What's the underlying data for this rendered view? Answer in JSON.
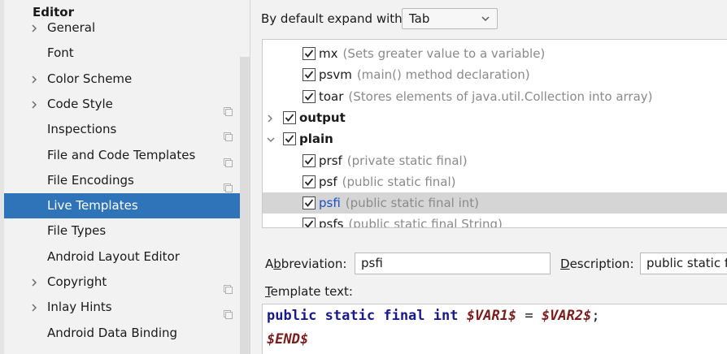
{
  "sidebar": {
    "group_title": "Editor",
    "items": [
      {
        "label": "General",
        "expandable": true,
        "project_icon": false
      },
      {
        "label": "Font",
        "expandable": false,
        "project_icon": false
      },
      {
        "label": "Color Scheme",
        "expandable": true,
        "project_icon": false
      },
      {
        "label": "Code Style",
        "expandable": true,
        "project_icon": true
      },
      {
        "label": "Inspections",
        "expandable": false,
        "project_icon": true
      },
      {
        "label": "File and Code Templates",
        "expandable": false,
        "project_icon": true
      },
      {
        "label": "File Encodings",
        "expandable": false,
        "project_icon": true
      },
      {
        "label": "Live Templates",
        "expandable": false,
        "project_icon": false,
        "selected": true
      },
      {
        "label": "File Types",
        "expandable": false,
        "project_icon": false
      },
      {
        "label": "Android Layout Editor",
        "expandable": false,
        "project_icon": false
      },
      {
        "label": "Copyright",
        "expandable": true,
        "project_icon": true
      },
      {
        "label": "Inlay Hints",
        "expandable": true,
        "project_icon": true
      },
      {
        "label": "Android Data Binding",
        "expandable": false,
        "project_icon": false
      }
    ]
  },
  "expand": {
    "label": "By default expand with",
    "value": "Tab"
  },
  "templates": {
    "rows": [
      {
        "name": "mx",
        "desc": "(Sets greater value to a variable)",
        "checked": true
      },
      {
        "name": "psvm",
        "desc": "(main() method declaration)",
        "checked": true
      },
      {
        "name": "toar",
        "desc": "(Stores elements of java.util.Collection into array)",
        "checked": true
      },
      {
        "name": "output",
        "desc": "",
        "checked": true,
        "group": true,
        "expanded": false
      },
      {
        "name": "plain",
        "desc": "",
        "checked": true,
        "group": true,
        "expanded": true
      },
      {
        "name": "prsf",
        "desc": "(private static final)",
        "checked": true
      },
      {
        "name": "psf",
        "desc": "(public static final)",
        "checked": true
      },
      {
        "name": "psfi",
        "desc": "(public static final int)",
        "checked": true,
        "selected": true
      },
      {
        "name": "psfs",
        "desc": "(public static final String)",
        "checked": true
      }
    ]
  },
  "abbreviation": {
    "label_prefix": "A",
    "label_mnemonic": "b",
    "label_rest": "breviation:",
    "value": "psfi"
  },
  "description": {
    "label_mnemonic": "D",
    "label_rest": "escription:",
    "value": "public static final int"
  },
  "template_text": {
    "label_mnemonic": "T",
    "label_rest": "emplate text:",
    "line1": {
      "kw1": "public",
      "kw2": "static",
      "kw3": "final",
      "kw4": "int",
      "var1": "$VAR1$",
      "eq": "=",
      "var2": "$VAR2$",
      "semi": ";"
    },
    "line2": {
      "end": "$END$"
    }
  },
  "colors": {
    "selection": "#2f74b8",
    "row_highlight": "#d5d5d5",
    "keyword": "#1a1a8a",
    "variable": "#7a1d1d"
  }
}
